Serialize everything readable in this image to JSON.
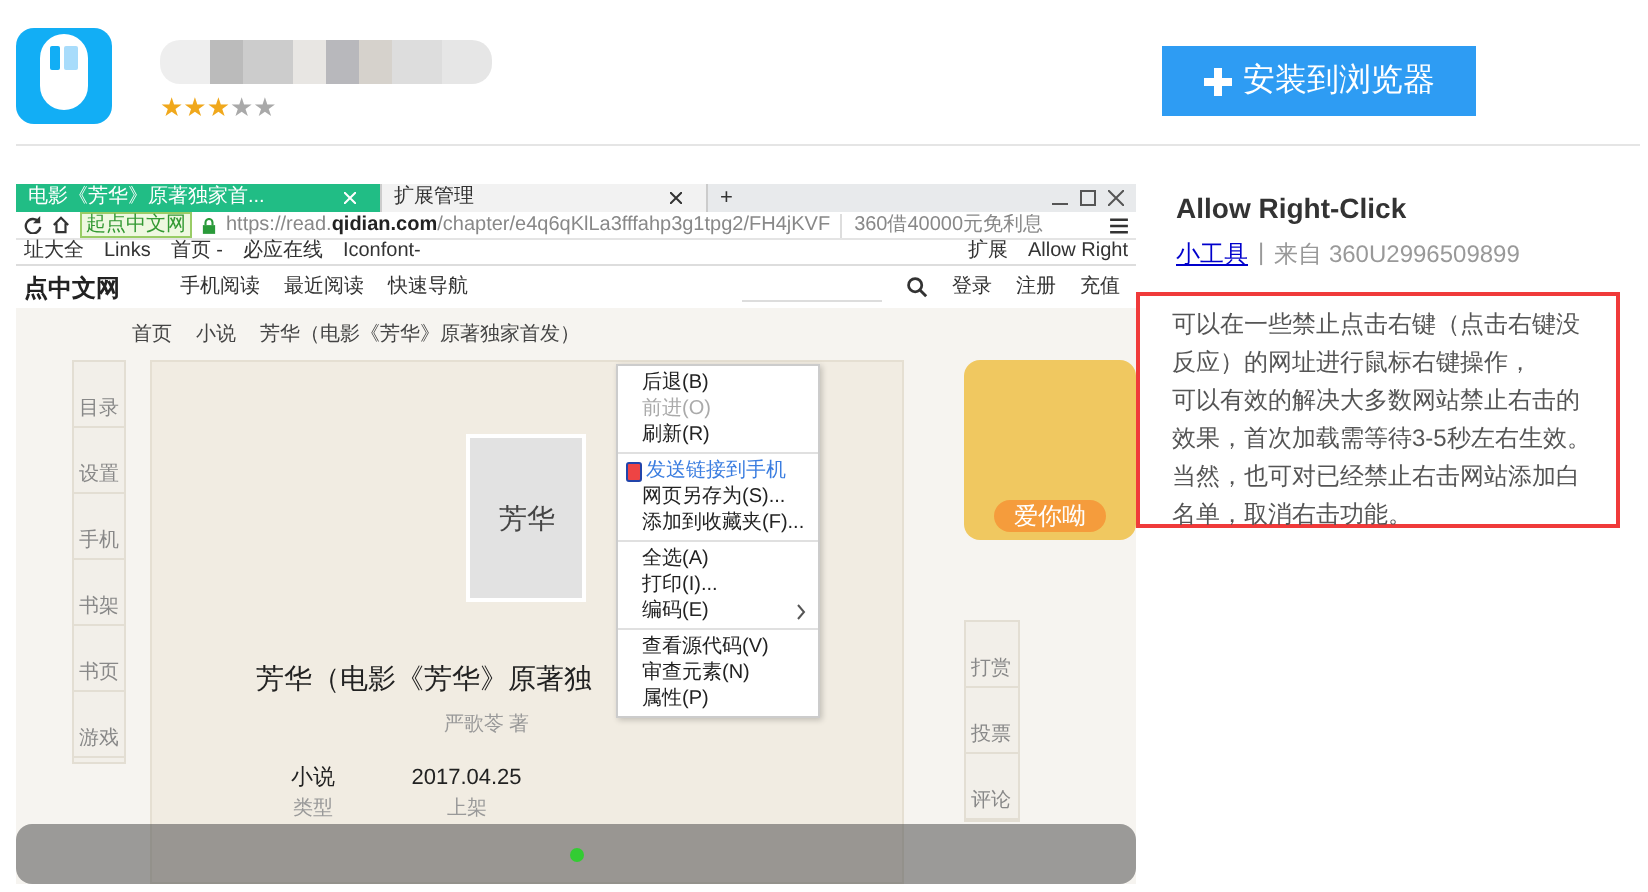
{
  "extension": {
    "stars": 3,
    "install_button": "安装到浏览器"
  },
  "preview": {
    "tabs": [
      {
        "label": "电影《芳华》原著独家首...",
        "selected": true
      },
      {
        "label": "扩展管理",
        "selected": false
      }
    ],
    "new_tab": "+",
    "address": {
      "site_badge": "起点中文网",
      "url_scheme": "https://read.",
      "url_host": "qidian.com",
      "url_path": "/chapter/e4q6qKlLa3fffahp3g1tpg2/FH4jKVF",
      "search_hint": "360借40000元免利息"
    },
    "bookmarks": [
      "址大全",
      "Links",
      "首页 -",
      "必应在线",
      "Iconfont-"
    ],
    "extension_items": [
      "扩展",
      "Allow Right"
    ],
    "site": {
      "logo": "点中文网",
      "nav": [
        "手机阅读",
        "最近阅读",
        "快速导航"
      ],
      "account": [
        "登录",
        "注册",
        "充值"
      ]
    },
    "breadcrumb": [
      "首页",
      "小说",
      "芳华（电影《芳华》原著独家首发）"
    ],
    "left_tools": [
      "目录",
      "设置",
      "手机",
      "书架",
      "书页",
      "游戏"
    ],
    "cover_text": "芳华",
    "book_title": "芳华（电影《芳华》原著独",
    "author": "严歌苓 著",
    "info": [
      {
        "value": "小说",
        "label": "类型"
      },
      {
        "value": "2017.04.25",
        "label": "上架"
      }
    ],
    "ad_text": "爱你呦",
    "right_tools": [
      "打赏",
      "投票",
      "评论"
    ],
    "context_menu": [
      {
        "label": "后退(B)",
        "disabled": false,
        "divider_before": false,
        "submenu": false,
        "kind": "item"
      },
      {
        "label": "前进(O)",
        "disabled": true,
        "divider_before": false,
        "submenu": false,
        "kind": "item"
      },
      {
        "label": "刷新(R)",
        "disabled": false,
        "divider_before": false,
        "submenu": false,
        "kind": "item"
      },
      {
        "label": "发送链接到手机",
        "disabled": false,
        "divider_before": true,
        "submenu": false,
        "kind": "phone"
      },
      {
        "label": "网页另存为(S)...",
        "disabled": false,
        "divider_before": false,
        "submenu": false,
        "kind": "item"
      },
      {
        "label": "添加到收藏夹(F)...",
        "disabled": false,
        "divider_before": false,
        "submenu": false,
        "kind": "item"
      },
      {
        "label": "全选(A)",
        "disabled": false,
        "divider_before": true,
        "submenu": false,
        "kind": "item"
      },
      {
        "label": "打印(I)...",
        "disabled": false,
        "divider_before": false,
        "submenu": false,
        "kind": "item"
      },
      {
        "label": "编码(E)",
        "disabled": false,
        "divider_before": false,
        "submenu": true,
        "kind": "item"
      },
      {
        "label": "查看源代码(V)",
        "disabled": false,
        "divider_before": true,
        "submenu": false,
        "kind": "item"
      },
      {
        "label": "审查元素(N)",
        "disabled": false,
        "divider_before": false,
        "submenu": false,
        "kind": "item"
      },
      {
        "label": "属性(P)",
        "disabled": false,
        "divider_before": false,
        "submenu": false,
        "kind": "item"
      }
    ]
  },
  "details": {
    "name": "Allow Right-Click",
    "category": "小工具",
    "separator": "|",
    "source": "来自 360U2996509899",
    "description": [
      "可以在一些禁止点击右键（点击右键没反应）的网址进行鼠标右键操作，",
      "可以有效的解决大多数网站禁止右击的效果，首次加载需等待3-5秒左右生效。当然，也可对已经禁止右击网站添加白名单，取消右击功能。"
    ]
  }
}
